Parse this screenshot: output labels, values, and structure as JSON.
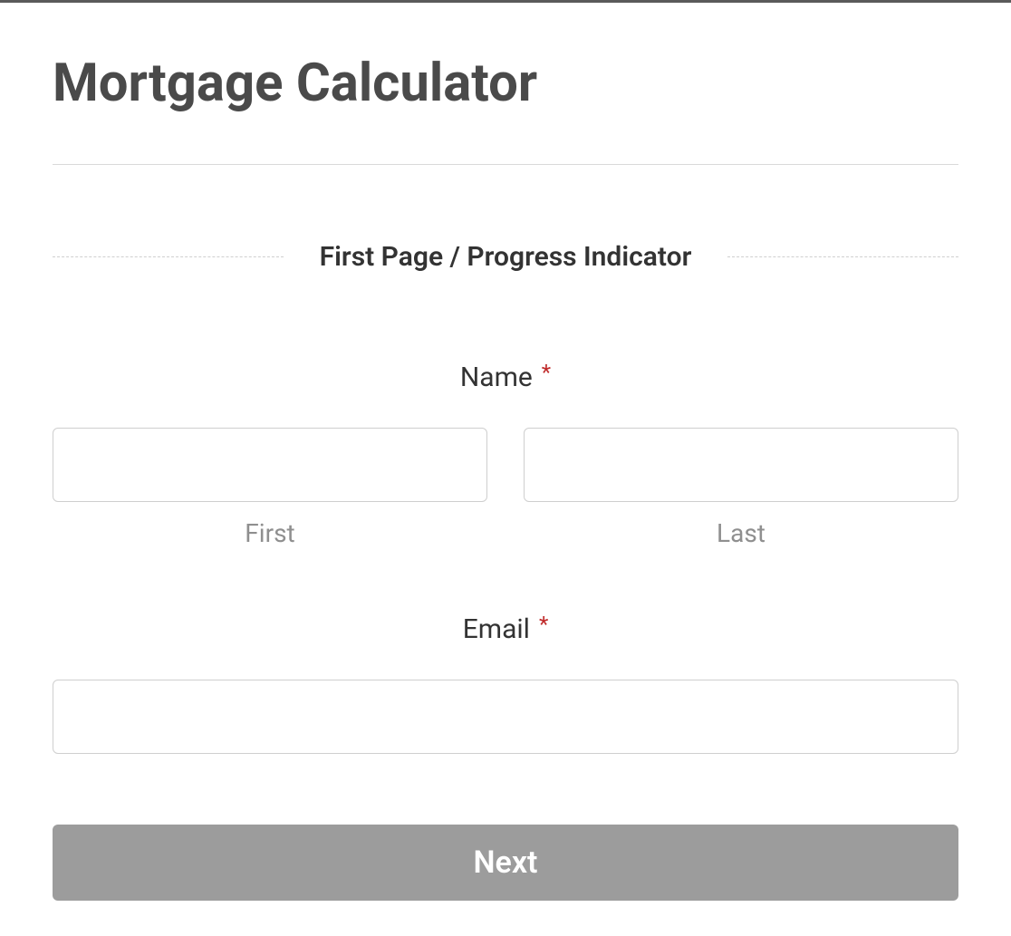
{
  "header": {
    "title": "Mortgage Calculator"
  },
  "section": {
    "heading": "First Page / Progress Indicator"
  },
  "form": {
    "name": {
      "label": "Name",
      "required_mark": "*",
      "first": {
        "sublabel": "First",
        "value": ""
      },
      "last": {
        "sublabel": "Last",
        "value": ""
      }
    },
    "email": {
      "label": "Email",
      "required_mark": "*",
      "value": ""
    },
    "next_button": "Next"
  }
}
